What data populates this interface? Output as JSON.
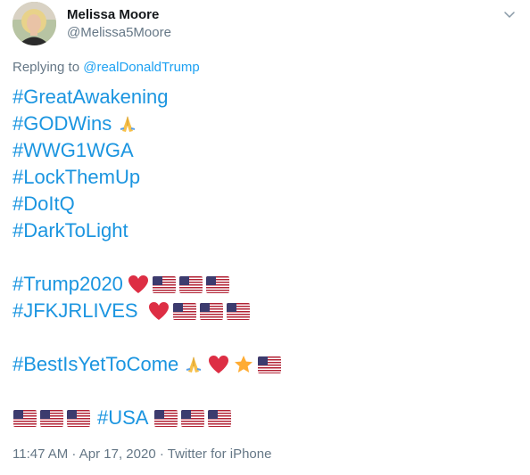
{
  "author": {
    "name": "Melissa Moore",
    "handle": "@Melissa5Moore"
  },
  "reply": {
    "prefix": "Replying to ",
    "to": "@realDonaldTrump"
  },
  "hashtags": {
    "great_awakening": "#GreatAwakening",
    "god_wins": "#GODWins",
    "wwg1wga": "#WWG1WGA",
    "lock_them_up": "#LockThemUp",
    "do_it_q": "#DoItQ",
    "dark_to_light": "#DarkToLight",
    "trump2020": "#Trump2020",
    "jfkjr_lives": "#JFKJRLIVES",
    "best_is_yet": "#BestIsYetToCome",
    "usa": "#USA"
  },
  "meta": {
    "timestamp": "11:47 AM · Apr 17, 2020 · ",
    "source": "Twitter for iPhone"
  },
  "icons": {
    "chevron": "chevron-down-icon",
    "flag": "us-flag-icon",
    "heart": "red-heart-icon",
    "pray": "folded-hands-icon",
    "star": "star-icon"
  },
  "colors": {
    "link": "#1b95e0",
    "secondary": "#657786",
    "text": "#14171a"
  }
}
